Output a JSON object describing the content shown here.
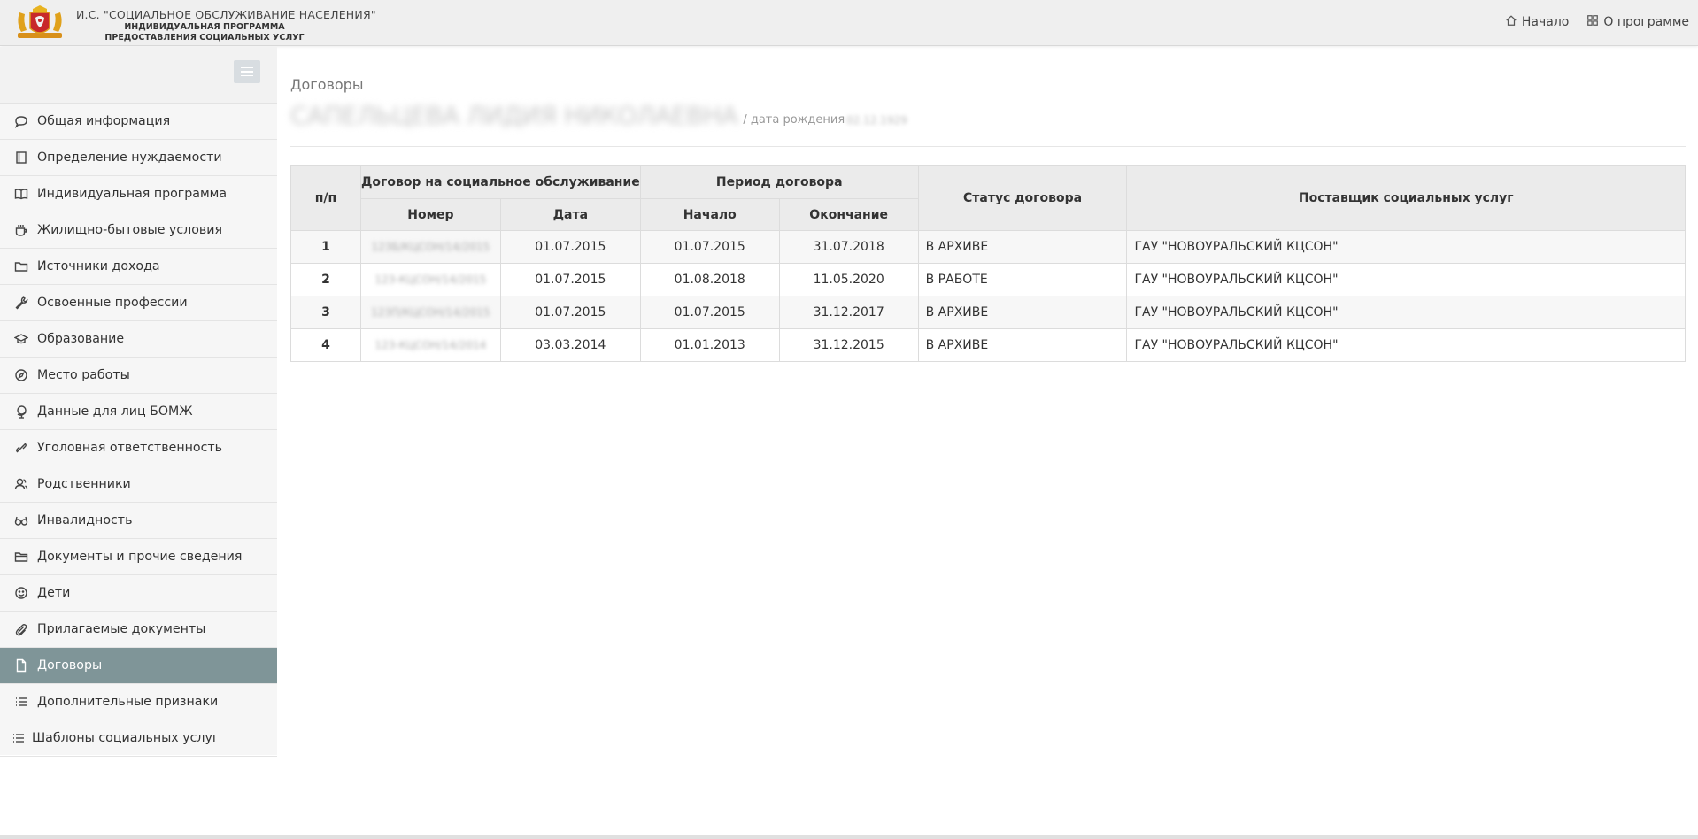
{
  "header": {
    "title_line1": "И.С. \"СОЦИАЛЬНОЕ ОБСЛУЖИВАНИЕ НАСЕЛЕНИЯ\"",
    "title_line2": "ИНДИВИДУАЛЬНАЯ ПРОГРАММА",
    "title_line3": "ПРЕДОСТАВЛЕНИЯ СОЦИАЛЬНЫХ УСЛУГ",
    "nav": [
      {
        "label": "Начало",
        "icon": "home-icon"
      },
      {
        "label": "О программе",
        "icon": "grid-icon"
      }
    ]
  },
  "sidebar": {
    "items": [
      {
        "label": "Общая информация",
        "icon": "speech-bubble-icon"
      },
      {
        "label": "Определение нуждаемости",
        "icon": "notebook-icon"
      },
      {
        "label": "Индивидуальная программа",
        "icon": "open-book-icon"
      },
      {
        "label": "Жилищно-бытовые условия",
        "icon": "cup-icon"
      },
      {
        "label": "Источники дохода",
        "icon": "folder-icon"
      },
      {
        "label": "Освоенные профессии",
        "icon": "wrench-icon"
      },
      {
        "label": "Образование",
        "icon": "graduation-cap-icon"
      },
      {
        "label": "Место работы",
        "icon": "compass-icon"
      },
      {
        "label": "Данные для лиц БОМЖ",
        "icon": "globe-icon"
      },
      {
        "label": "Уголовная ответственность",
        "icon": "link-icon"
      },
      {
        "label": "Родственники",
        "icon": "users-icon"
      },
      {
        "label": "Инвалидность",
        "icon": "glasses-icon"
      },
      {
        "label": "Документы и прочие сведения",
        "icon": "folder-open-icon"
      },
      {
        "label": "Дети",
        "icon": "smile-icon"
      },
      {
        "label": "Прилагаемые документы",
        "icon": "paperclip-icon"
      },
      {
        "label": "Договоры",
        "icon": "document-icon",
        "active": true
      },
      {
        "label": "Дополнительные признаки",
        "icon": "list-icon"
      },
      {
        "label": "Шаблоны социальных услуг",
        "icon": "list-icon"
      }
    ]
  },
  "main": {
    "page_title": "Договоры",
    "person_name": "САПЕЛЬЦЕВА ЛИДИЯ НИКОЛАЕВНА",
    "dob_label": "/ дата рождения",
    "dob_value": "02.12.1929",
    "table": {
      "headers": {
        "index": "п/п",
        "contract_group": "Договор на социальное обслуживание",
        "number": "Номер",
        "date": "Дата",
        "period_group": "Период договора",
        "start": "Начало",
        "end": "Окончание",
        "status": "Статус договора",
        "provider": "Поставщик социальных услуг"
      },
      "rows": [
        {
          "index": "1",
          "number": "123Б/КЦСОН/14/2015",
          "date": "01.07.2015",
          "start": "01.07.2015",
          "end": "31.07.2018",
          "status": "В АРХИВЕ",
          "provider": "ГАУ \"НОВОУРАЛЬСКИЙ КЦСОН\""
        },
        {
          "index": "2",
          "number": "123-КЦСОН/14/2015",
          "date": "01.07.2015",
          "start": "01.08.2018",
          "end": "11.05.2020",
          "status": "В РАБОТЕ",
          "provider": "ГАУ \"НОВОУРАЛЬСКИЙ КЦСОН\""
        },
        {
          "index": "3",
          "number": "123П/КЦСОН/14/2015",
          "date": "01.07.2015",
          "start": "01.07.2015",
          "end": "31.12.2017",
          "status": "В АРХИВЕ",
          "provider": "ГАУ \"НОВОУРАЛЬСКИЙ КЦСОН\""
        },
        {
          "index": "4",
          "number": "123-КЦСОН/14/2014",
          "date": "03.03.2014",
          "start": "01.01.2013",
          "end": "31.12.2015",
          "status": "В АРХИВЕ",
          "provider": "ГАУ \"НОВОУРАЛЬСКИЙ КЦСОН\""
        }
      ]
    }
  },
  "colors": {
    "active_item": "#7f9598",
    "header_bg": "#efefef",
    "sidebar_bg": "#f6f6f6",
    "table_header_bg": "#ebebeb"
  }
}
